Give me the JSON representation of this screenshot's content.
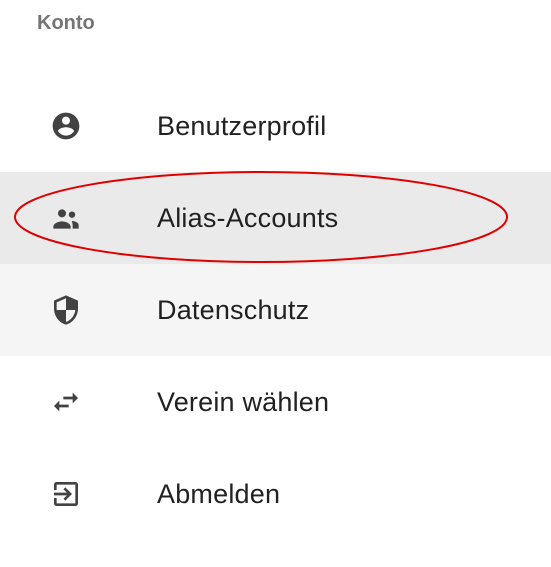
{
  "section": {
    "title": "Konto"
  },
  "menu": {
    "items": [
      {
        "label": "Benutzerprofil",
        "icon": "account-circle-icon"
      },
      {
        "label": "Alias-Accounts",
        "icon": "people-icon"
      },
      {
        "label": "Datenschutz",
        "icon": "shield-icon"
      },
      {
        "label": "Verein wählen",
        "icon": "swap-arrows-icon"
      },
      {
        "label": "Abmelden",
        "icon": "logout-icon"
      }
    ]
  },
  "colors": {
    "highlight_bg": "#eaeaea",
    "light_bg": "#f5f5f5",
    "annotation_red": "#e00000",
    "icon": "#424242",
    "header_text": "#757575"
  }
}
